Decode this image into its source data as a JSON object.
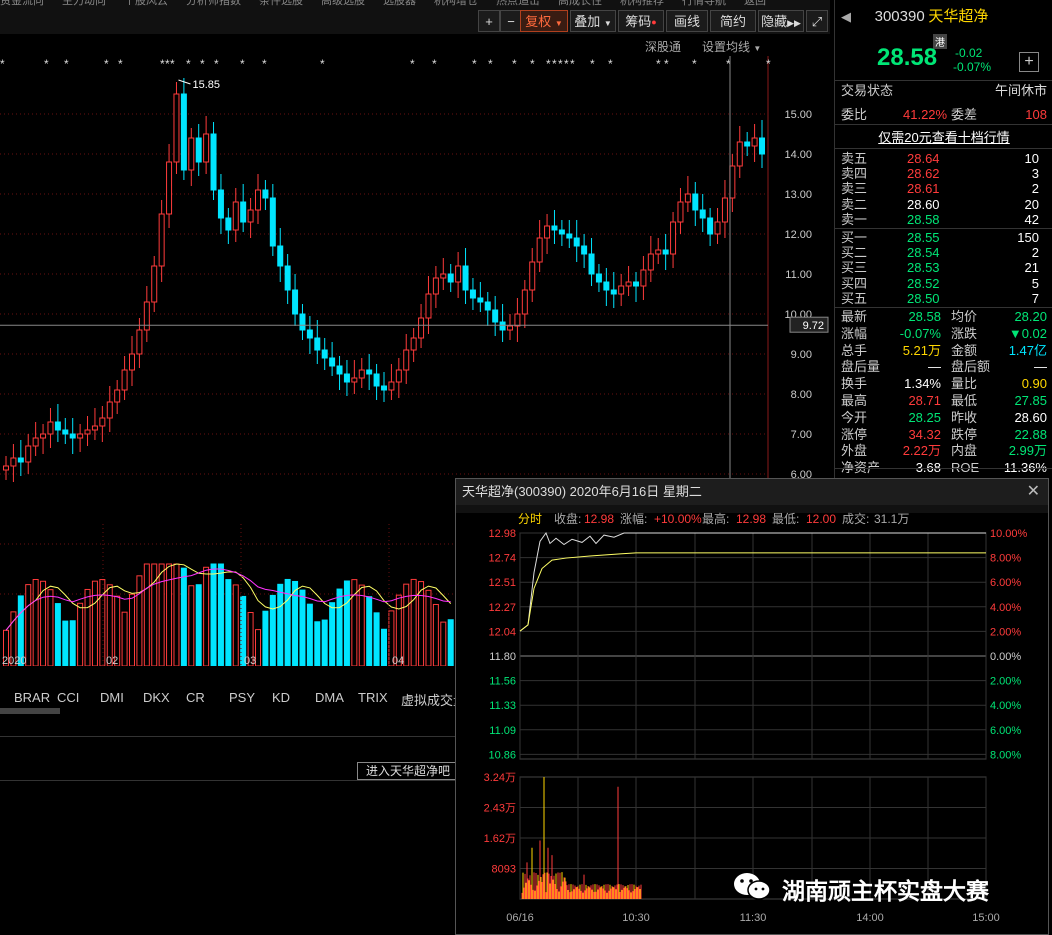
{
  "toolbar": {
    "top_menu": [
      "资金流向",
      "主力动向",
      "个股风云",
      "分析师指数",
      "条件选股",
      "高级选股",
      "选股器",
      "机构增仓",
      "热点追击",
      "高成长性",
      "机构推荐",
      "行情导航",
      "返回"
    ],
    "plus": "+",
    "minus": "−",
    "fuquan": "复权",
    "overlay": "叠加",
    "chips": "筹码",
    "draw_line": "画线",
    "simple": "简约",
    "hide": "隐藏",
    "expand_icon": "expand-icon"
  },
  "subbar": {
    "shengutong": "深股通",
    "ma_settings": "设置均线"
  },
  "kline": {
    "high_marker": "15.85",
    "price_axis": [
      "15.00",
      "14.00",
      "13.00",
      "12.00",
      "11.00",
      "10.00",
      "9.00",
      "8.00",
      "7.00",
      "6.00"
    ],
    "crosshair_price": "9.72",
    "time_labels": [
      "2020",
      "02",
      "03",
      "04"
    ]
  },
  "indicator_tabs": [
    "BRAR",
    "CCI",
    "DMI",
    "DKX",
    "CR",
    "PSY",
    "KD",
    "DMA",
    "TRIX",
    "虚拟成交量"
  ],
  "enter_button": "进入天华超净吧",
  "quote": {
    "code": "300390",
    "name": "天华超净",
    "hk_tag": "港",
    "price": "28.58",
    "change": "-0.02",
    "change_pct": "-0.07%",
    "status_label": "交易状态",
    "status_value": "午间休市",
    "weibi_label": "委比",
    "weibi_value": "41.22%",
    "weicha_label": "委差",
    "weicha_value": "108",
    "ten_level_link": "仅需20元查看十档行情",
    "asks": [
      {
        "label": "卖五",
        "price": "28.64",
        "vol": "10"
      },
      {
        "label": "卖四",
        "price": "28.62",
        "vol": "3"
      },
      {
        "label": "卖三",
        "price": "28.61",
        "vol": "2"
      },
      {
        "label": "卖二",
        "price": "28.60",
        "vol": "20"
      },
      {
        "label": "卖一",
        "price": "28.58",
        "vol": "42"
      }
    ],
    "bids": [
      {
        "label": "买一",
        "price": "28.55",
        "vol": "150"
      },
      {
        "label": "买二",
        "price": "28.54",
        "vol": "2"
      },
      {
        "label": "买三",
        "price": "28.53",
        "vol": "21"
      },
      {
        "label": "买四",
        "price": "28.52",
        "vol": "5"
      },
      {
        "label": "买五",
        "price": "28.50",
        "vol": "7"
      }
    ],
    "stats": [
      {
        "l1": "最新",
        "v1": "28.58",
        "c1": "green",
        "l2": "均价",
        "v2": "28.20",
        "c2": "green"
      },
      {
        "l1": "涨幅",
        "v1": "-0.07%",
        "c1": "green",
        "l2": "涨跌",
        "v2": "▼0.02",
        "c2": "green"
      },
      {
        "l1": "总手",
        "v1": "5.21万",
        "c1": "yellow",
        "l2": "金额",
        "v2": "1.47亿",
        "c2": "cyan"
      },
      {
        "l1": "盘后量",
        "v1": "—",
        "c1": "white",
        "l2": "盘后额",
        "v2": "—",
        "c2": "white"
      },
      {
        "l1": "换手",
        "v1": "1.34%",
        "c1": "white",
        "l2": "量比",
        "v2": "0.90",
        "c2": "yellow"
      },
      {
        "l1": "最高",
        "v1": "28.71",
        "c1": "red",
        "l2": "最低",
        "v2": "27.85",
        "c2": "green"
      },
      {
        "l1": "今开",
        "v1": "28.25",
        "c1": "green",
        "l2": "昨收",
        "v2": "28.60",
        "c2": "white"
      },
      {
        "l1": "涨停",
        "v1": "34.32",
        "c1": "red",
        "l2": "跌停",
        "v2": "22.88",
        "c2": "green"
      },
      {
        "l1": "外盘",
        "v1": "2.22万",
        "c1": "red",
        "l2": "内盘",
        "v2": "2.99万",
        "c2": "green"
      },
      {
        "l1": "净资产",
        "v1": "3.68",
        "c1": "white",
        "l2": "ROE",
        "v2": "11.36%",
        "c2": "white"
      }
    ]
  },
  "popup": {
    "title": "天华超净(300390) 2020年6月16日 星期二",
    "tab": "分时",
    "close_label": "收盘:",
    "close_value": "12.98",
    "chg_label": "涨幅:",
    "chg_value": "+10.00%",
    "high_label": "最高:",
    "high_value": "12.98",
    "low_label": "最低:",
    "low_value": "12.00",
    "vol_label": "成交:",
    "vol_value": "31.1万",
    "price_axis_left": [
      "12.98",
      "12.74",
      "12.51",
      "12.27",
      "12.04",
      "11.80",
      "11.56",
      "11.33",
      "11.09",
      "10.86"
    ],
    "pct_axis_right": [
      "10.00%",
      "8.00%",
      "6.00%",
      "4.00%",
      "2.00%",
      "0.00%",
      "2.00%",
      "4.00%",
      "6.00%",
      "8.00%"
    ],
    "vol_axis": [
      "3.24万",
      "2.43万",
      "1.62万",
      "8093"
    ],
    "time_axis": [
      "06/16",
      "10:30",
      "11:30",
      "14:00",
      "15:00"
    ]
  },
  "watermark": {
    "icon": "wechat-icon",
    "text": "湖南顽主杯实盘大赛"
  },
  "colors": {
    "up": "#ff3b3b",
    "down": "#00e5ff",
    "grid": "#7a1010",
    "ma_yellow": "#ffff66",
    "ma_magenta": "#ff33ff"
  }
}
